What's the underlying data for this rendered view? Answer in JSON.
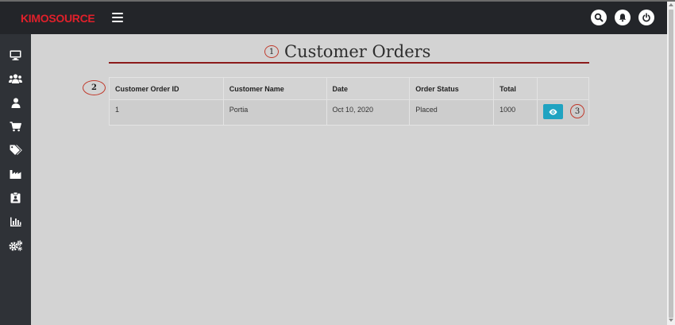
{
  "app": {
    "logo": "KIMOSOURCE"
  },
  "topbar": {
    "icons": [
      "search-icon",
      "bell-icon",
      "power-icon"
    ]
  },
  "sidebar": {
    "items": [
      {
        "icon": "desktop-icon"
      },
      {
        "icon": "users-icon"
      },
      {
        "icon": "user-icon"
      },
      {
        "icon": "cart-icon"
      },
      {
        "icon": "tags-icon"
      },
      {
        "icon": "industry-icon"
      },
      {
        "icon": "id-badge-icon"
      },
      {
        "icon": "bar-chart-icon"
      },
      {
        "icon": "gears-icon"
      }
    ]
  },
  "page": {
    "title": "Customer Orders",
    "markers": {
      "one": "1",
      "two": "2",
      "three": "3"
    }
  },
  "table": {
    "columns": [
      "Customer Order ID",
      "Customer Name",
      "Date",
      "Order Status",
      "Total",
      ""
    ],
    "rows": [
      {
        "id": "1",
        "name": "Portia",
        "date": "Oct 10, 2020",
        "status": "Placed",
        "total": "1000",
        "action_icon": "eye-icon"
      }
    ]
  },
  "colors": {
    "brand": "#e0202a",
    "topbar": "#232529",
    "sidebar": "#2f3237",
    "accent": "#1fa3c1",
    "rule": "#8b1a1a"
  }
}
